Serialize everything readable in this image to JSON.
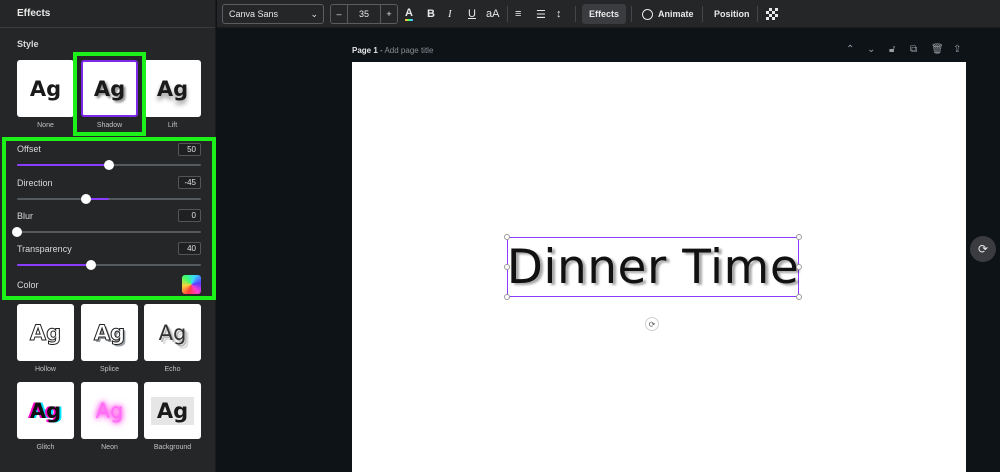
{
  "panel": {
    "title": "Effects",
    "style_title": "Style",
    "styles": [
      {
        "sample": "Ag",
        "label": "None"
      },
      {
        "sample": "Ag",
        "label": "Shadow"
      },
      {
        "sample": "Ag",
        "label": "Lift"
      },
      {
        "sample": "Ag",
        "label": "Hollow"
      },
      {
        "sample": "Ag",
        "label": "Splice"
      },
      {
        "sample": "Ag",
        "label": "Echo"
      },
      {
        "sample": "Ag",
        "label": "Glitch"
      },
      {
        "sample": "Ag",
        "label": "Neon"
      },
      {
        "sample": "Ag",
        "label": "Background"
      }
    ],
    "selected_style": "Shadow",
    "highlight_color": "#1cf21a",
    "accent_color": "#8b3dff",
    "settings": {
      "offset": {
        "label": "Offset",
        "value": "50",
        "fraction": 0.5
      },
      "direction": {
        "label": "Direction",
        "value": "-45",
        "fraction": 0.375
      },
      "blur": {
        "label": "Blur",
        "value": "0",
        "fraction": 0.0
      },
      "transparency": {
        "label": "Transparency",
        "value": "40",
        "fraction": 0.4
      },
      "color": {
        "label": "Color"
      }
    }
  },
  "toolbar": {
    "font": "Canva Sans",
    "font_chevron": "chevron-down-icon",
    "minus": "–",
    "size": "35",
    "plus": "+",
    "text_color_icon": "A",
    "bold": "B",
    "italic": "I",
    "underline": "U",
    "case": "aA",
    "align_icon": "≡",
    "list_icon": "☰",
    "spacing_icon": "↕",
    "effects": "Effects",
    "animate": "Animate",
    "position": "Position",
    "transparency_icon": "checker-icon"
  },
  "page": {
    "label": "Page 1",
    "separator": " - ",
    "add_title": "Add page title"
  },
  "canvas": {
    "text": "Dinner Time"
  }
}
